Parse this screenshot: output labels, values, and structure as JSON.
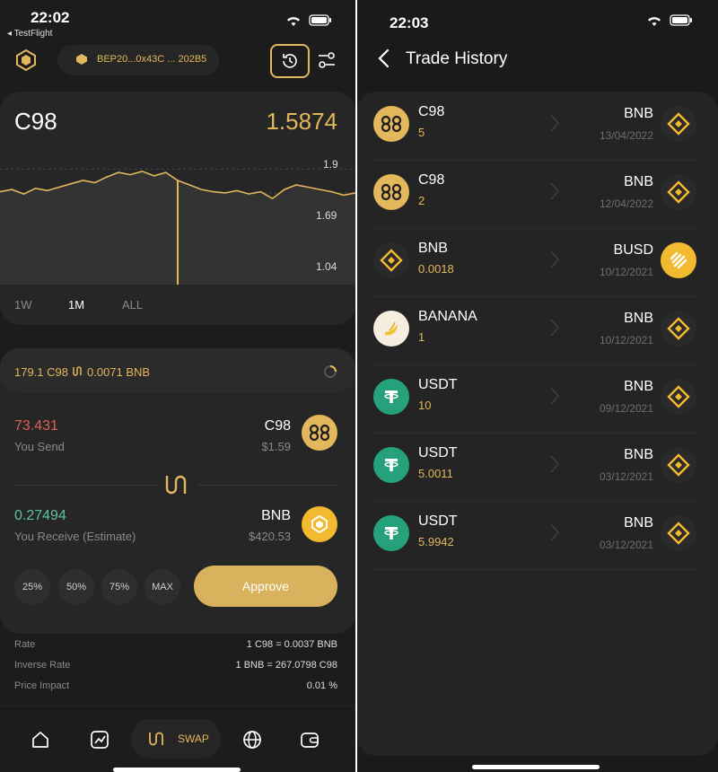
{
  "left": {
    "status": {
      "time": "22:02",
      "back_label": "◂ TestFlight"
    },
    "header": {
      "network_label": "BEP20...0x43C ... 202B5"
    },
    "chart": {
      "token": "C98",
      "price": "1.5874",
      "ticks": [
        "1.9",
        "1.69",
        "1.04"
      ],
      "ranges": [
        "1W",
        "1M",
        "ALL"
      ],
      "selected_range": "1M"
    },
    "chart_data": {
      "type": "line",
      "title": "",
      "x": [
        0,
        1,
        2,
        3,
        4,
        5,
        6,
        7,
        8,
        9,
        10,
        11,
        12,
        13,
        14,
        15,
        16,
        17,
        18,
        19,
        20,
        21,
        22,
        23,
        24,
        25,
        26,
        27,
        28,
        29,
        30
      ],
      "series": [
        {
          "values": [
            1.7,
            1.72,
            1.68,
            1.73,
            1.71,
            1.74,
            1.77,
            1.8,
            1.78,
            1.83,
            1.87,
            1.85,
            1.88,
            1.84,
            1.87,
            1.8,
            1.76,
            1.72,
            1.7,
            1.69,
            1.71,
            1.68,
            1.7,
            1.64,
            1.72,
            1.76,
            1.74,
            1.72,
            1.7,
            1.67,
            1.69
          ]
        }
      ],
      "yticks": [
        1.04,
        1.69,
        1.9
      ]
    },
    "swap": {
      "rate_line": "179.1 C98",
      "rate_line2": "0.0071 BNB",
      "send_amount": "73.431",
      "send_label": "You Send",
      "send_token": "C98",
      "send_value": "$1.59",
      "receive_amount": "0.27494",
      "receive_label": "You Receive (Estimate)",
      "receive_token": "BNB",
      "receive_value": "$420.53",
      "percent_buttons": [
        "25%",
        "50%",
        "75%",
        "MAX"
      ],
      "approve_label": "Approve"
    },
    "details": [
      {
        "label": "Rate",
        "value": "1 C98 = 0.0037 BNB"
      },
      {
        "label": "Inverse Rate",
        "value": "1 BNB = 267.0798 C98"
      },
      {
        "label": "Price Impact",
        "value": "0.01 %"
      }
    ],
    "nav": {
      "swap_label": "SWAP"
    }
  },
  "right": {
    "status": {
      "time": "22:03"
    },
    "title": "Trade History",
    "trades": [
      {
        "from": "C98",
        "amount": "5",
        "to": "BNB",
        "date": "13/04/2022",
        "from_icon": "c98-icon",
        "to_icon": "bnb-icon"
      },
      {
        "from": "C98",
        "amount": "2",
        "to": "BNB",
        "date": "12/04/2022",
        "from_icon": "c98-icon",
        "to_icon": "bnb-icon"
      },
      {
        "from": "BNB",
        "amount": "0.0018",
        "to": "BUSD",
        "date": "10/12/2021",
        "from_icon": "bnb-icon",
        "to_icon": "busd-icon"
      },
      {
        "from": "BANANA",
        "amount": "1",
        "to": "BNB",
        "date": "10/12/2021",
        "from_icon": "banana-icon",
        "to_icon": "bnb-icon"
      },
      {
        "from": "USDT",
        "amount": "10",
        "to": "BNB",
        "date": "09/12/2021",
        "from_icon": "usdt-icon",
        "to_icon": "bnb-icon"
      },
      {
        "from": "USDT",
        "amount": "5.0011",
        "to": "BNB",
        "date": "03/12/2021",
        "from_icon": "usdt-icon",
        "to_icon": "bnb-icon"
      },
      {
        "from": "USDT",
        "amount": "5.9942",
        "to": "BNB",
        "date": "03/12/2021",
        "from_icon": "usdt-icon",
        "to_icon": "bnb-icon"
      }
    ]
  },
  "colors": {
    "gold": "#e3b75b",
    "bnb": "#f3ba2f",
    "usdt": "#26a17b",
    "red": "#e0605a",
    "green": "#5cc49a"
  }
}
